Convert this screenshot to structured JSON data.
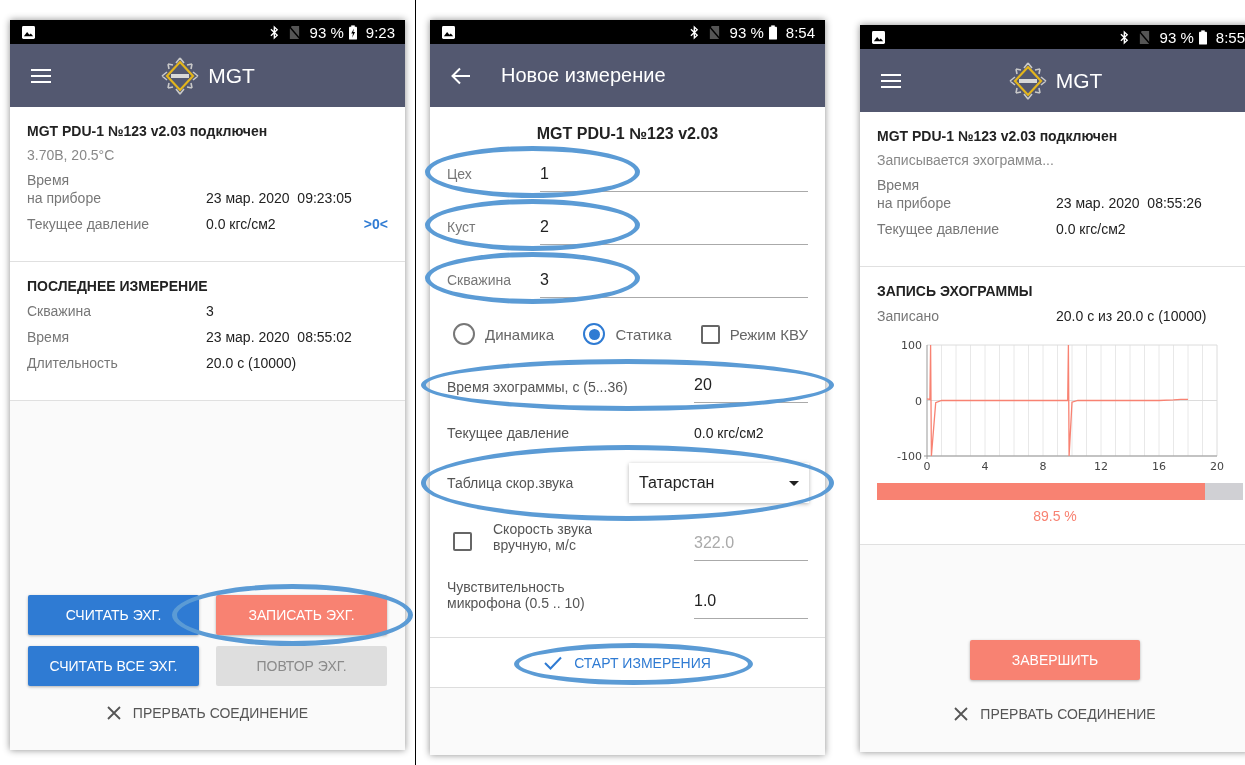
{
  "screens": [
    {
      "kind": "home",
      "status_bar": {
        "battery": "93 %",
        "charging": true,
        "time": "9:23"
      },
      "app_bar": {
        "kind": "menu",
        "title": "MGT"
      },
      "sections": [
        {
          "kind": "info",
          "title": "MGT PDU-1 №123 v2.03 подключен",
          "subtitle": "3.70В, 20.5°C",
          "rows": [
            {
              "label": "Время\nна приборе",
              "value": "23 мар. 2020  09:23:05"
            },
            {
              "label": "Текущее давление",
              "value": "0.0 кгс/см2",
              "action": ">0<"
            }
          ]
        },
        {
          "kind": "info",
          "title": "ПОСЛЕДНЕЕ ИЗМЕРЕНИЕ",
          "rows": [
            {
              "label": "Скважина",
              "value": "3"
            },
            {
              "label": "Время",
              "value": "23 мар. 2020  08:55:02"
            },
            {
              "label": "Длительность",
              "value": "20.0 с (10000)"
            }
          ]
        }
      ],
      "buttons": [
        {
          "label": "СЧИТАТЬ ЭХГ.",
          "kind": "primary",
          "highlighted": false
        },
        {
          "label": "ЗАПИСАТЬ ЭХГ.",
          "kind": "accent",
          "highlighted": true
        },
        {
          "label": "СЧИТАТЬ ВСЕ ЭХГ.",
          "kind": "primary",
          "highlighted": false
        },
        {
          "label": "ПОВТОР ЭХГ.",
          "kind": "disabled",
          "highlighted": false
        }
      ],
      "footer_action": {
        "label": "ПРЕРВАТЬ СОЕДИНЕНИЕ"
      }
    },
    {
      "kind": "form",
      "status_bar": {
        "battery": "93 %",
        "charging": false,
        "time": "8:54"
      },
      "app_bar": {
        "kind": "back",
        "title": "Новое измерение"
      },
      "device_title": "MGT PDU-1 №123 v2.03",
      "fields": [
        {
          "label": "Цех",
          "value": "1",
          "highlighted": true
        },
        {
          "label": "Куст",
          "value": "2",
          "highlighted": true
        },
        {
          "label": "Скважина",
          "value": "3",
          "highlighted": true
        }
      ],
      "options": [
        {
          "kind": "radio",
          "label": "Динамика",
          "checked": false
        },
        {
          "kind": "radio",
          "label": "Статика",
          "checked": true
        },
        {
          "kind": "checkbox",
          "label": "Режим КВУ",
          "checked": false
        }
      ],
      "rows": [
        {
          "kind": "text",
          "label": "Время эхограммы, с (5...36)",
          "value": "20",
          "highlighted": true
        },
        {
          "kind": "readout",
          "label": "Текущее давление",
          "value": "0.0 кгс/см2",
          "highlighted": false
        },
        {
          "kind": "dropdown",
          "label": "Таблица скор.звука",
          "value": "Татарстан",
          "highlighted": true
        },
        {
          "kind": "check-text",
          "label": "Скорость звука\nвручную, м/с",
          "placeholder": "322.0",
          "checked": false,
          "highlighted": false
        },
        {
          "kind": "text",
          "label": "Чувствительность\nмикрофона (0.5 .. 10)",
          "value": "1.0",
          "highlighted": false
        }
      ],
      "start_button": {
        "label": "СТАРТ ИЗМЕРЕНИЯ",
        "highlighted": true
      }
    },
    {
      "kind": "recording",
      "status_bar": {
        "battery": "93 %",
        "charging": false,
        "time": "8:55"
      },
      "app_bar": {
        "kind": "menu",
        "title": "MGT"
      },
      "sections": [
        {
          "kind": "info",
          "title": "MGT PDU-1 №123 v2.03 подключен",
          "subtitle": "Записывается эхограмма...",
          "rows": [
            {
              "label": "Время\nна приборе",
              "value": "23 мар. 2020  08:55:26"
            },
            {
              "label": "Текущее давление",
              "value": "0.0 кгс/см2"
            }
          ]
        },
        {
          "kind": "recording",
          "title": "ЗАПИСЬ ЭХОГРАММЫ",
          "rows": [
            {
              "label": "Записано",
              "value": "20.0 с из 20.0 с (10000)"
            }
          ],
          "chart_data": {
            "type": "line",
            "x": [
              0,
              0.2,
              0.25,
              0.3,
              0.6,
              1,
              9.7,
              9.75,
              9.8,
              10,
              10.4,
              16,
              17,
              17.5,
              18
            ],
            "grid": true,
            "series": [
              {
                "color": "#f88272",
                "values": [
                  3,
                  2,
                  100,
                  -100,
                  -4,
                  0,
                  0,
                  100,
                  -100,
                  -3,
                  0,
                  0,
                  1,
                  2,
                  2
                ]
              }
            ],
            "xlim": [
              0,
              20
            ],
            "ylim": [
              -100,
              100
            ],
            "xticks": [
              0,
              4,
              8,
              12,
              16,
              20
            ],
            "yticks": [
              -100,
              0,
              100
            ]
          },
          "progress": {
            "level": 0.895,
            "reading": "89.5 %"
          }
        }
      ],
      "buttons": [
        {
          "label": "ЗАВЕРШИТЬ",
          "kind": "accent",
          "highlighted": false
        }
      ],
      "footer_action": {
        "label": "ПРЕРВАТЬ СОЕДИНЕНИЕ"
      }
    }
  ]
}
